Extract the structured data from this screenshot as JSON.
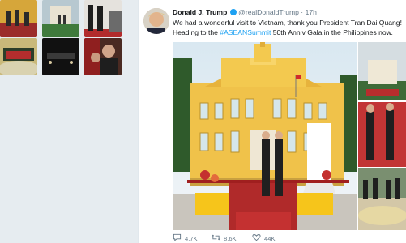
{
  "tweet": {
    "author_name": "Donald J. Trump",
    "author_handle": "@realDonaldTrump",
    "separator": "·",
    "time": "17h",
    "text_before_hashtag": "We had a wonderful visit to Vietnam, thank you President Tran Dai Quang! Heading to the ",
    "hashtag": "#ASEANSummit",
    "text_after_hashtag": " 50th Anniv Gala in the Philippines now."
  },
  "actions": {
    "reply_count": "4.7K",
    "retweet_count": "8.6K",
    "like_count": "44K"
  },
  "icons": {
    "reply": "speech-bubble-icon",
    "retweet": "retweet-arrows-icon",
    "like": "heart-icon"
  },
  "colors": {
    "background": "#e6ecf0",
    "card": "#ffffff",
    "text": "#14171a",
    "muted": "#657786",
    "link": "#1da1f2"
  }
}
